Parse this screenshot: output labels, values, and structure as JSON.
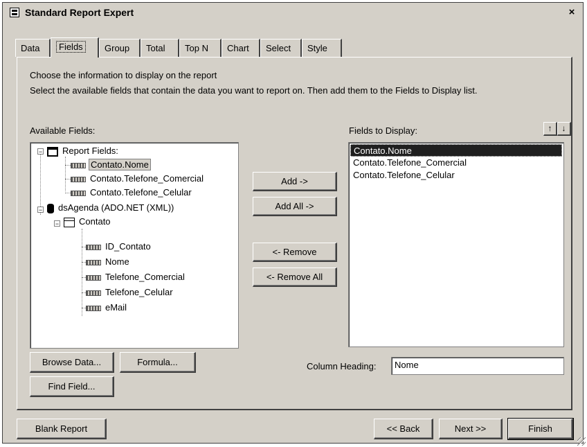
{
  "window": {
    "title": "Standard Report Expert",
    "close": "×"
  },
  "tabs": [
    {
      "label": "Data",
      "active": false
    },
    {
      "label": "Fields",
      "active": true
    },
    {
      "label": "Group",
      "active": false
    },
    {
      "label": "Total",
      "active": false
    },
    {
      "label": "Top N",
      "active": false
    },
    {
      "label": "Chart",
      "active": false
    },
    {
      "label": "Select",
      "active": false
    },
    {
      "label": "Style",
      "active": false
    }
  ],
  "instructions": {
    "line1": "Choose the information to display on the report",
    "line2": "Select the available fields that contain the data you want to report on.  Then add them to the Fields to Display list."
  },
  "available": {
    "label": "Available Fields:",
    "tree": {
      "report_fields": "Report Fields:",
      "report_items": [
        "Contato.Nome",
        "Contato.Telefone_Comercial",
        "Contato.Telefone_Celular"
      ],
      "dataset": "dsAgenda (ADO.NET (XML))",
      "table": "Contato",
      "table_items": [
        "ID_Contato",
        "Nome",
        "Telefone_Comercial",
        "Telefone_Celular",
        "eMail"
      ]
    }
  },
  "buttons": {
    "add": "Add ->",
    "add_all": "Add All ->",
    "remove": "<- Remove",
    "remove_all": "<- Remove All",
    "browse": "Browse Data...",
    "formula": "Formula...",
    "find": "Find Field...",
    "up": "↑",
    "down": "↓"
  },
  "display": {
    "label": "Fields to Display:",
    "items": [
      "Contato.Nome",
      "Contato.Telefone_Comercial",
      "Contato.Telefone_Celular"
    ],
    "selected_index": 0
  },
  "column_heading": {
    "label": "Column Heading:",
    "value": "Nome"
  },
  "footer": {
    "blank": "Blank Report",
    "back": "<< Back",
    "next": "Next >>",
    "finish": "Finish"
  }
}
